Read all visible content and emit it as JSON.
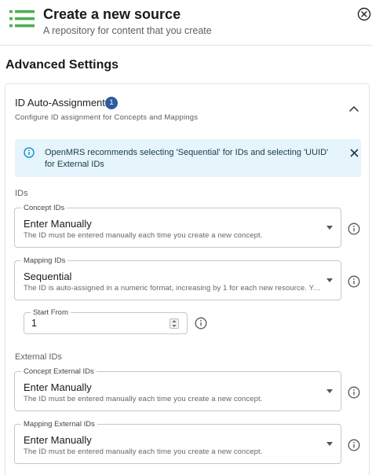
{
  "header": {
    "title": "Create a new source",
    "subtitle": "A repository for content that you create",
    "icon": "list-icon",
    "accent_color": "#4caf50"
  },
  "section": {
    "title": "Advanced Settings"
  },
  "panel": {
    "title": "ID Auto-Assignment",
    "badge": "1",
    "description": "Configure ID assignment for Concepts and Mappings",
    "badge_color": "#2d5aa0"
  },
  "alert": {
    "text": "OpenMRS recommends selecting 'Sequential' for IDs and selecting 'UUID' for External IDs",
    "background": "#e6f4fb"
  },
  "ids_group": {
    "label": "IDs",
    "concept_ids": {
      "label": "Concept IDs",
      "value": "Enter Manually",
      "help": "The ID must be entered manually each time you create a new concept."
    },
    "mapping_ids": {
      "label": "Mapping IDs",
      "value": "Sequential",
      "help": "The ID is auto-assigned in a numeric format, increasing by 1 for each new resource. You c..."
    },
    "start_from": {
      "label": "Start From",
      "value": "1"
    }
  },
  "external_group": {
    "label": "External IDs",
    "concept_external_ids": {
      "label": "Concept External IDs",
      "value": "Enter Manually",
      "help": "The ID must be entered manually each time you create a new concept."
    },
    "mapping_external_ids": {
      "label": "Mapping External IDs",
      "value": "Enter Manually",
      "help": "The ID must be entered manually each time you create a new concept."
    }
  }
}
